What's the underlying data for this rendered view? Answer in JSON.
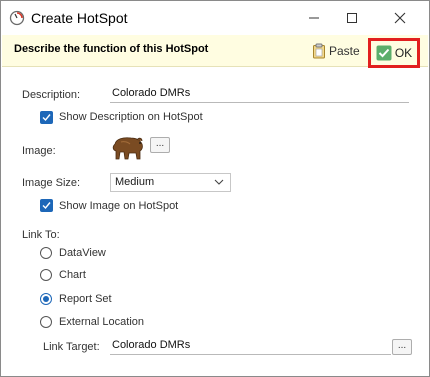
{
  "window": {
    "title": "Create HotSpot",
    "minimize_glyph": "—",
    "maximize_glyph": "☐",
    "close_glyph": "✕"
  },
  "banner": {
    "text": "Describe the function of this HotSpot",
    "paste_label": "Paste",
    "ok_label": "OK",
    "highlight_color": "#e21f1f",
    "banner_color": "#fffde1"
  },
  "form": {
    "description_label": "Description:",
    "description_value": "Colorado DMRs",
    "show_description_label": "Show Description on HotSpot",
    "show_description_checked": true,
    "image_label": "Image:",
    "image_icon": "bear-icon",
    "image_browse_label": "...",
    "image_size_label": "Image Size:",
    "image_size_value": "Medium",
    "show_image_label": "Show Image on HotSpot",
    "show_image_checked": true,
    "link_to_label": "Link To:",
    "link_options": [
      {
        "label": "DataView",
        "selected": false
      },
      {
        "label": "Chart",
        "selected": false
      },
      {
        "label": "Report Set",
        "selected": true
      },
      {
        "label": "External Location",
        "selected": false
      }
    ],
    "link_target_label": "Link Target:",
    "link_target_value": "Colorado DMRs",
    "link_target_browse_label": "..."
  },
  "colors": {
    "accent": "#1d67b8"
  }
}
